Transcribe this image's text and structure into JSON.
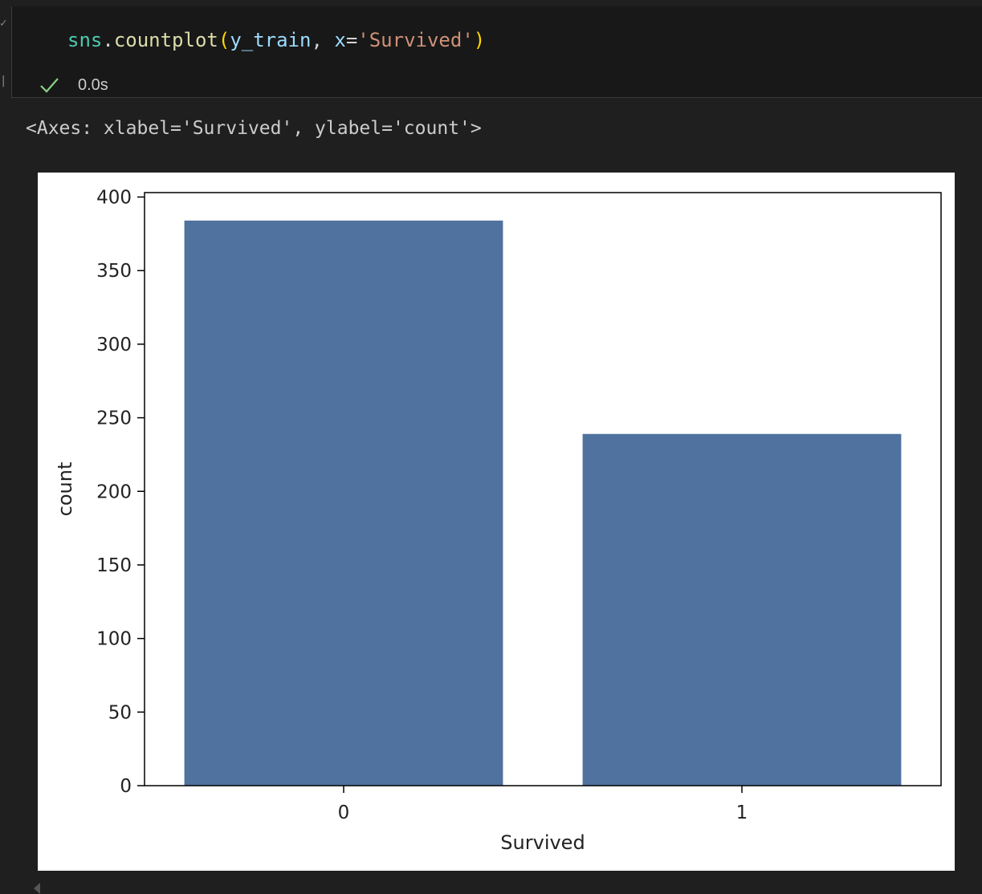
{
  "cell": {
    "code": {
      "module": "sns",
      "dot": ".",
      "function": "countplot",
      "open_paren": "(",
      "arg1": "y_train",
      "sep": ", ",
      "kw": "x",
      "eq": "=",
      "string": "'Survived'",
      "close_paren": ")"
    },
    "exec_time": "0.0s",
    "status_icon": "check-icon"
  },
  "output": {
    "text": "<Axes: xlabel='Survived', ylabel='count'>"
  },
  "chart_data": {
    "type": "bar",
    "categories": [
      "0",
      "1"
    ],
    "values": [
      384,
      239
    ],
    "xlabel": "Survived",
    "ylabel": "count",
    "ylim": [
      0,
      403
    ],
    "yticks": [
      0,
      50,
      100,
      150,
      200,
      250,
      300,
      350,
      400
    ],
    "bar_color": "#4f729e",
    "grid": false
  }
}
